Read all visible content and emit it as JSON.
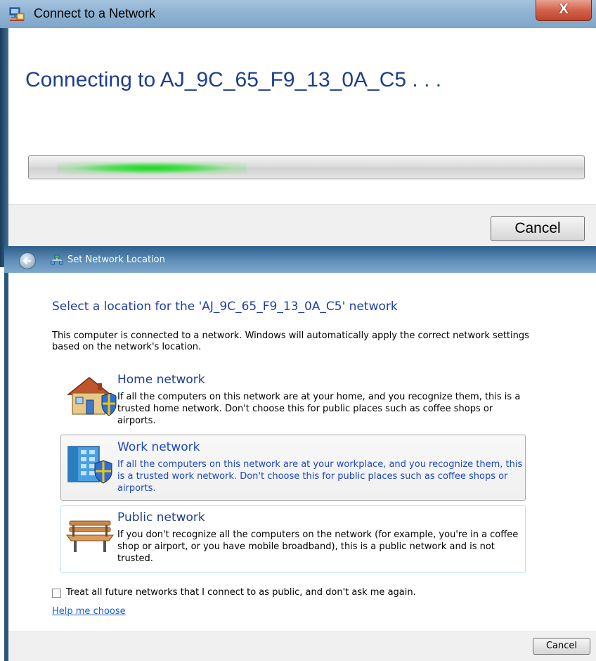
{
  "connect_dialog": {
    "title": "Connect to a Network",
    "close_label": "X",
    "heading": "Connecting to AJ_9C_65_F9_13_0A_C5 . . .",
    "progress_state": "indeterminate",
    "cancel_label": "Cancel"
  },
  "location_window": {
    "title": "Set Network Location",
    "heading": "Select a location for the 'AJ_9C_65_F9_13_0A_C5' network",
    "description": "This computer is connected to a network. Windows will automatically apply the correct network settings based on the network's location.",
    "options": [
      {
        "icon": "house-shield-icon",
        "title": "Home network",
        "description": "If all the computers on this network are at your home, and you recognize them, this is a trusted home network.  Don't choose this for public places such as coffee shops or airports."
      },
      {
        "icon": "office-building-shield-icon",
        "title": "Work network",
        "description": "If all the computers on this network are at your workplace, and you recognize them, this is a trusted work network.  Don't choose this for public places such as coffee shops or airports."
      },
      {
        "icon": "park-bench-icon",
        "title": "Public network",
        "description": "If you don't recognize all the computers on the network (for example, you're in a coffee shop or airport, or you have mobile broadband), this is a public network and is not trusted."
      }
    ],
    "checkbox_label": "Treat all future networks that I connect to as public, and don't ask me again.",
    "checkbox_checked": false,
    "help_link": "Help me choose",
    "cancel_label": "Cancel"
  },
  "colors": {
    "heading_blue": "#1e3e8f",
    "hover_blue": "#1c48c4",
    "link_blue": "#1a5fcf",
    "progress_green": "#22d12a"
  }
}
